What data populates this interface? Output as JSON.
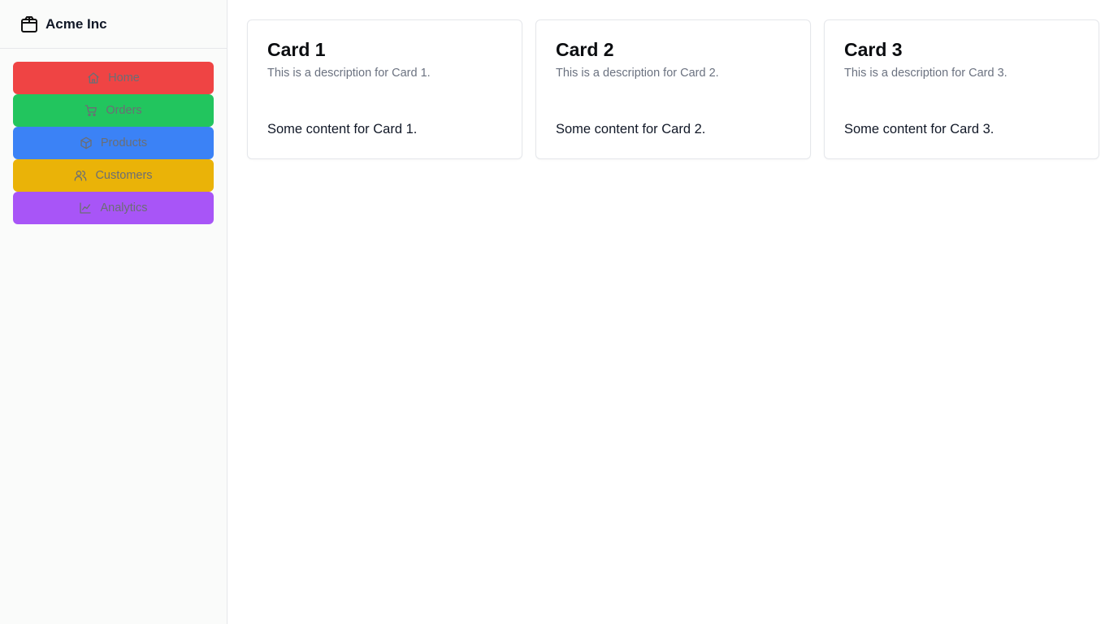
{
  "brand": {
    "name": "Acme Inc",
    "icon": "package-icon"
  },
  "nav": {
    "items": [
      {
        "label": "Home",
        "icon": "home-icon",
        "color": "#ef4444"
      },
      {
        "label": "Orders",
        "icon": "shopping-cart-icon",
        "color": "#22c55e"
      },
      {
        "label": "Products",
        "icon": "package-icon",
        "color": "#3b82f6"
      },
      {
        "label": "Customers",
        "icon": "users-icon",
        "color": "#eab308"
      },
      {
        "label": "Analytics",
        "icon": "line-chart-icon",
        "color": "#a855f7"
      }
    ]
  },
  "cards": [
    {
      "title": "Card 1",
      "description": "This is a description for Card 1.",
      "content": "Some content for Card 1."
    },
    {
      "title": "Card 2",
      "description": "This is a description for Card 2.",
      "content": "Some content for Card 2."
    },
    {
      "title": "Card 3",
      "description": "This is a description for Card 3.",
      "content": "Some content for Card 3."
    }
  ]
}
